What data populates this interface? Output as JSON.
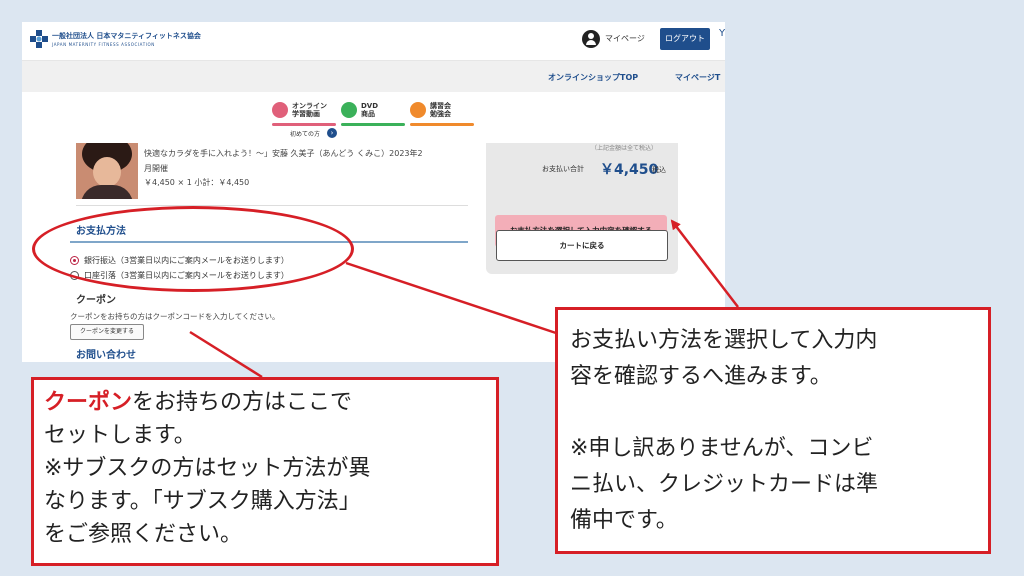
{
  "header": {
    "org_name": "一般社団法人 日本マタニティフィットネス協会",
    "org_sub": "JAPAN MATERNITY FITNESS ASSOCIATION",
    "mypage_label": "マイページ",
    "logout_label": "ログアウト",
    "cut_text": "Y"
  },
  "nav": {
    "shop_top": "オンラインショップTOP",
    "mypage_cut": "マイページT"
  },
  "categories": [
    {
      "label": "オンライン\n学習動画",
      "color": "#e0607a"
    },
    {
      "label": "DVD\n商品",
      "color": "#3bb15a"
    },
    {
      "label": "講習会\n勉強会",
      "color": "#f08a2c"
    }
  ],
  "first_time": "初めての方",
  "product": {
    "line1": "快適なカラダを手に入れよう！〜」安藤 久美子（あんどう くみこ）2023年2",
    "line2": "月開催",
    "line3": "￥4,450 × 1  小計：￥4,450"
  },
  "payment": {
    "title": "お支払方法",
    "options": [
      {
        "label": "銀行振込（3営業日以内にご案内メールをお送りします）",
        "selected": true
      },
      {
        "label": "口座引落（3営業日以内にご案内メールをお送りします）",
        "selected": false
      }
    ]
  },
  "coupon": {
    "title": "クーポン",
    "desc": "クーポンをお持ちの方はクーポンコードを入力してください。",
    "button": "クーポンを変更する"
  },
  "inquiry_title": "お問い合わせ",
  "summary": {
    "cut_text": "（上記金額は全て税込）",
    "total_label": "お支払い合計",
    "total_price": "￥4,450",
    "tax_label": "税込",
    "confirm_button": "お支払方法を選択して入力内容を確認する",
    "back_button": "カートに戻る"
  },
  "callout_left": {
    "highlight": "クーポン",
    "line1_rest": "をお持ちの方はここで",
    "line2": "セットします。",
    "line3": "※サブスクの方はセット方法が異",
    "line4": "なります。「サブスク購入方法」",
    "line5": "をご参照ください。"
  },
  "callout_right": {
    "line1": "お支払い方法を選択して入力内",
    "line2": "容を確認するへ進みます。",
    "line3": "※申し訳ありませんが、コンビ",
    "line4": "ニ払い、クレジットカードは準",
    "line5": "備中です。"
  },
  "colors": {
    "annotation_red": "#d61f26",
    "brand_blue": "#1f4e8c",
    "confirm_pink": "#f3aeb8",
    "background": "#dce6f1"
  }
}
